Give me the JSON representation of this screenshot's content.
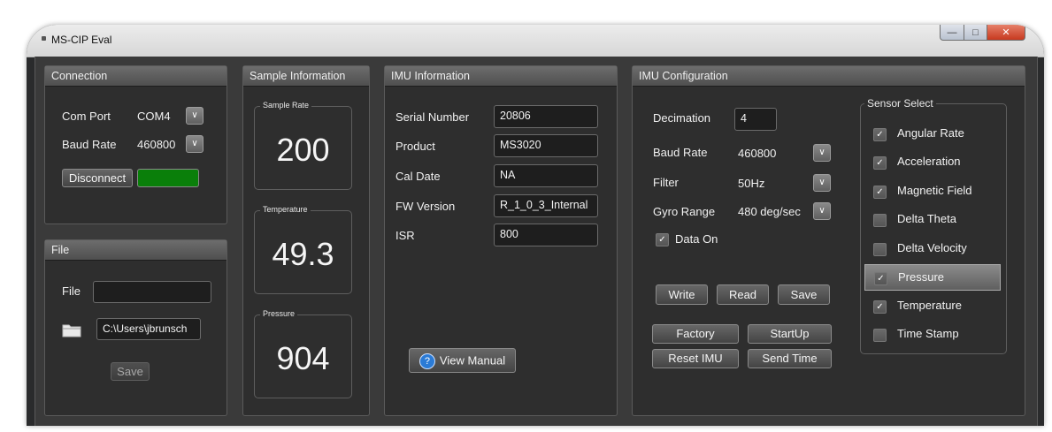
{
  "window": {
    "title": "MS-CIP Eval"
  },
  "connection": {
    "header": "Connection",
    "com_port_label": "Com Port",
    "com_port_value": "COM4",
    "baud_rate_label": "Baud Rate",
    "baud_rate_value": "460800",
    "disconnect_label": "Disconnect",
    "status_color": "#0a7f0a"
  },
  "file": {
    "header": "File",
    "file_label": "File",
    "file_value": "",
    "path_value": "C:\\Users\\jbrunsch",
    "save_label": "Save"
  },
  "sample_info": {
    "header": "Sample Information",
    "sample_rate_title": "Sample Rate",
    "sample_rate_value": "200",
    "temperature_title": "Temperature",
    "temperature_value": "49.3",
    "pressure_title": "Pressure",
    "pressure_value": "904"
  },
  "imu_info": {
    "header": "IMU Information",
    "rows": [
      {
        "label": "Serial Number",
        "value": "20806"
      },
      {
        "label": "Product",
        "value": "MS3020"
      },
      {
        "label": "Cal Date",
        "value": "NA"
      },
      {
        "label": "FW Version",
        "value": "R_1_0_3_Internal"
      },
      {
        "label": "ISR",
        "value": "800"
      }
    ],
    "view_manual_label": "View Manual"
  },
  "imu_config": {
    "header": "IMU Configuration",
    "decimation_label": "Decimation",
    "decimation_value": "4",
    "baud_rate_label": "Baud Rate",
    "baud_rate_value": "460800",
    "filter_label": "Filter",
    "filter_value": "50Hz",
    "gyro_range_label": "Gyro Range",
    "gyro_range_value": "480 deg/sec",
    "data_on_label": "Data On",
    "data_on_checked": true,
    "buttons": {
      "write": "Write",
      "read": "Read",
      "save": "Save",
      "factory": "Factory",
      "startup": "StartUp",
      "reset_imu": "Reset IMU",
      "send_time": "Send Time"
    },
    "sensor_select": {
      "title": "Sensor Select",
      "items": [
        {
          "label": "Angular Rate",
          "checked": true
        },
        {
          "label": "Acceleration",
          "checked": true
        },
        {
          "label": "Magnetic Field",
          "checked": true
        },
        {
          "label": "Delta Theta",
          "checked": false
        },
        {
          "label": "Delta Velocity",
          "checked": false
        },
        {
          "label": "Pressure",
          "checked": true,
          "selected": true
        },
        {
          "label": "Temperature",
          "checked": true
        },
        {
          "label": "Time Stamp",
          "checked": false
        }
      ]
    }
  }
}
